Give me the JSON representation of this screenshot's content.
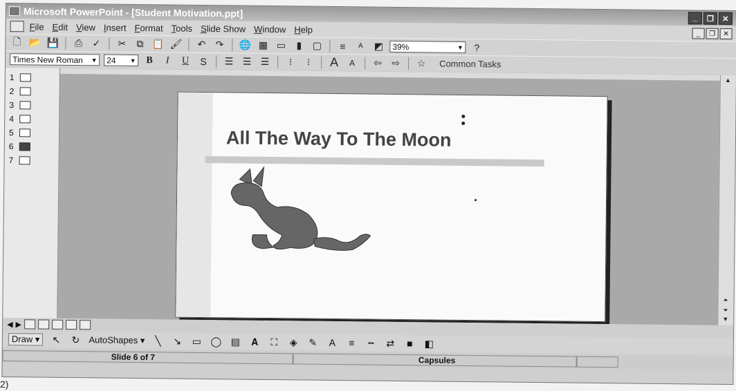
{
  "window": {
    "title": "Microsoft PowerPoint - [Student Motivation.ppt]"
  },
  "menu": {
    "items": [
      "File",
      "Edit",
      "View",
      "Insert",
      "Format",
      "Tools",
      "Slide Show",
      "Window",
      "Help"
    ]
  },
  "formatting": {
    "font_name": "Times New Roman",
    "font_size": "24",
    "zoom": "39%",
    "common_tasks": "Common Tasks"
  },
  "slides": {
    "numbers": [
      "1",
      "2",
      "3",
      "4",
      "5",
      "6",
      "7"
    ],
    "active_index": 6
  },
  "slide": {
    "title": "All The Way To The Moon"
  },
  "draw": {
    "draw_label": "Draw",
    "autoshapes_label": "AutoShapes"
  },
  "status": {
    "slide_position": "Slide 6 of 7",
    "design": "Capsules"
  },
  "caption": "2)",
  "colors": {
    "title_bar": "#9a9a9a",
    "slide_background": "#fafafa",
    "work_area": "#a9a9a9"
  }
}
